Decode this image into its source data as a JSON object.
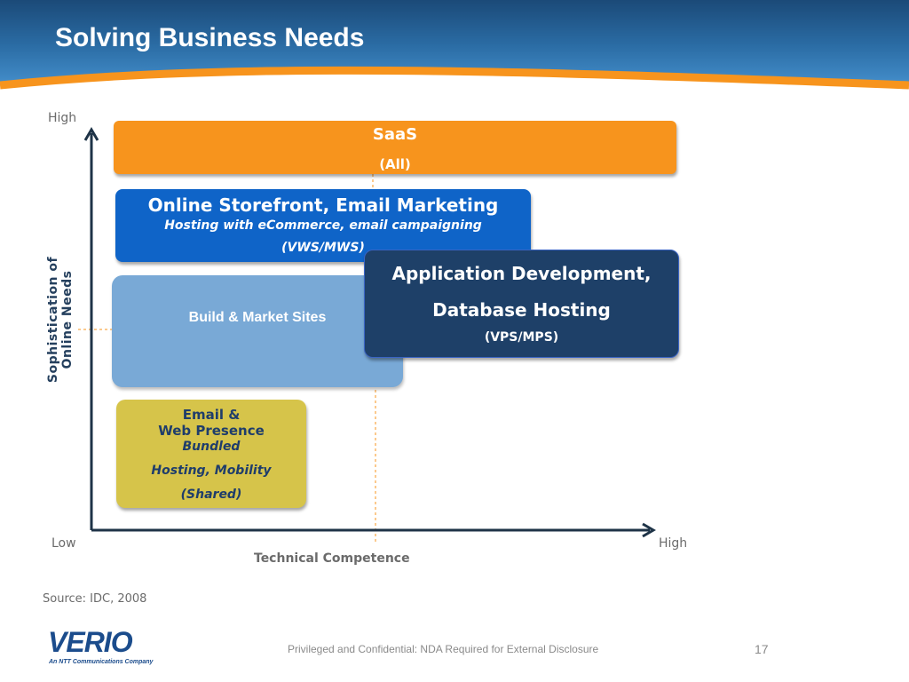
{
  "slide": {
    "title": "Solving Business Needs",
    "page_number": "17",
    "source": "Source: IDC, 2008",
    "confidentiality": "Privileged and Confidential: NDA Required for External Disclosure"
  },
  "logo": {
    "name": "VERIO",
    "tagline": "An NTT Communications Company"
  },
  "axes": {
    "y_high": "High",
    "y_title": "Sophistication of Online Needs",
    "x_low": "Low",
    "x_high": "High",
    "x_title": "Technical Competence"
  },
  "boxes": {
    "saas": {
      "title": "SaaS",
      "sub": "(All)"
    },
    "storefront": {
      "title": "Online Storefront, Email Marketing",
      "desc": "Hosting with eCommerce, email campaigning",
      "sub": "(VWS/MWS)"
    },
    "build": {
      "title": "Build & Market Sites"
    },
    "appdev": {
      "line1": "Application Development,",
      "line2": "Database Hosting",
      "sub": "(VPS/MPS)"
    },
    "email": {
      "line1": "Email &",
      "line2": "Web Presence",
      "line3": "Bundled",
      "line4": "Hosting, Mobility",
      "sub": "(Shared)"
    }
  },
  "colors": {
    "saas": "#f7941d",
    "storefront": "#0f64c8",
    "build": "#79a9d6",
    "appdev": "#1e4068",
    "email": "#d6c44a",
    "axis": "#1e3347",
    "guide": "#f7941d"
  }
}
